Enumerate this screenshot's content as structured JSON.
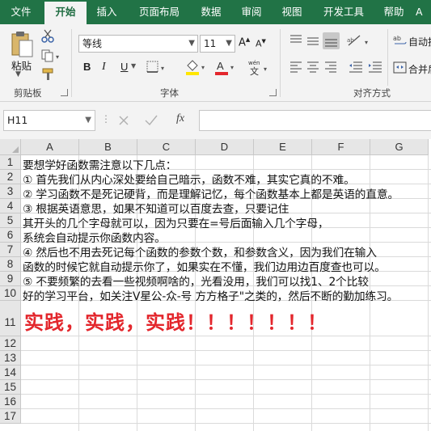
{
  "ribbon_tabs": [
    "文件",
    "开始",
    "插入",
    "页面布局",
    "数据",
    "审阅",
    "视图",
    "开发工具",
    "帮助",
    "A"
  ],
  "clipboard": {
    "paste_label": "粘贴",
    "group_label": "剪贴板"
  },
  "font": {
    "name": "等线",
    "size": "11",
    "group_label": "字体",
    "bold": "B",
    "italic": "I",
    "underline": "U",
    "phonetic_glyph": "wén",
    "font_color_glyph": "A"
  },
  "alignment": {
    "wrap_text": "自动换",
    "merge_center": "合并后",
    "group_label": "对齐方式"
  },
  "formula_bar": {
    "name_box": "H11",
    "fx_label": "fx",
    "formula": ""
  },
  "grid": {
    "columns": [
      "A",
      "B",
      "C",
      "D",
      "E",
      "F",
      "G"
    ],
    "rows": [
      "1",
      "2",
      "3",
      "4",
      "5",
      "6",
      "7",
      "8",
      "9",
      "10",
      "11",
      "12",
      "13",
      "14",
      "15",
      "16",
      "17"
    ],
    "cells_col_a": [
      "要想学好函数需注意以下几点：",
      "① 首先我们从内心深处要给自己暗示，函数不难，其实它真的不难。",
      "② 学习函数不是死记硬背，而是理解记忆，每个函数基本上都是英语的直意。",
      "③ 根据英语意思，如果不知道可以百度去查，只要记住",
      "其开头的几个字母就可以，因为只要在=号后面输入几个字母，",
      "系统会自动提示你函数内容。",
      "④ 然后也不用去死记每个函数的参数个数，和参数含义，因为我们在输入",
      "函数的时候它就自动提示你了，如果实在不懂，我们边用边百度查也可以。",
      "⑤ 不要频繁的去看一些视频啊啥的，光看没用，我们可以找1、2个比较",
      "好的学习平台，如关注V星公-众-号 方方格子\"之类的，然后不断的勤加练习。",
      "实践，实践，实践！！！！！！！"
    ]
  },
  "colors": {
    "ribbon_green": "#217346",
    "emphasis_red": "#e3262c"
  }
}
